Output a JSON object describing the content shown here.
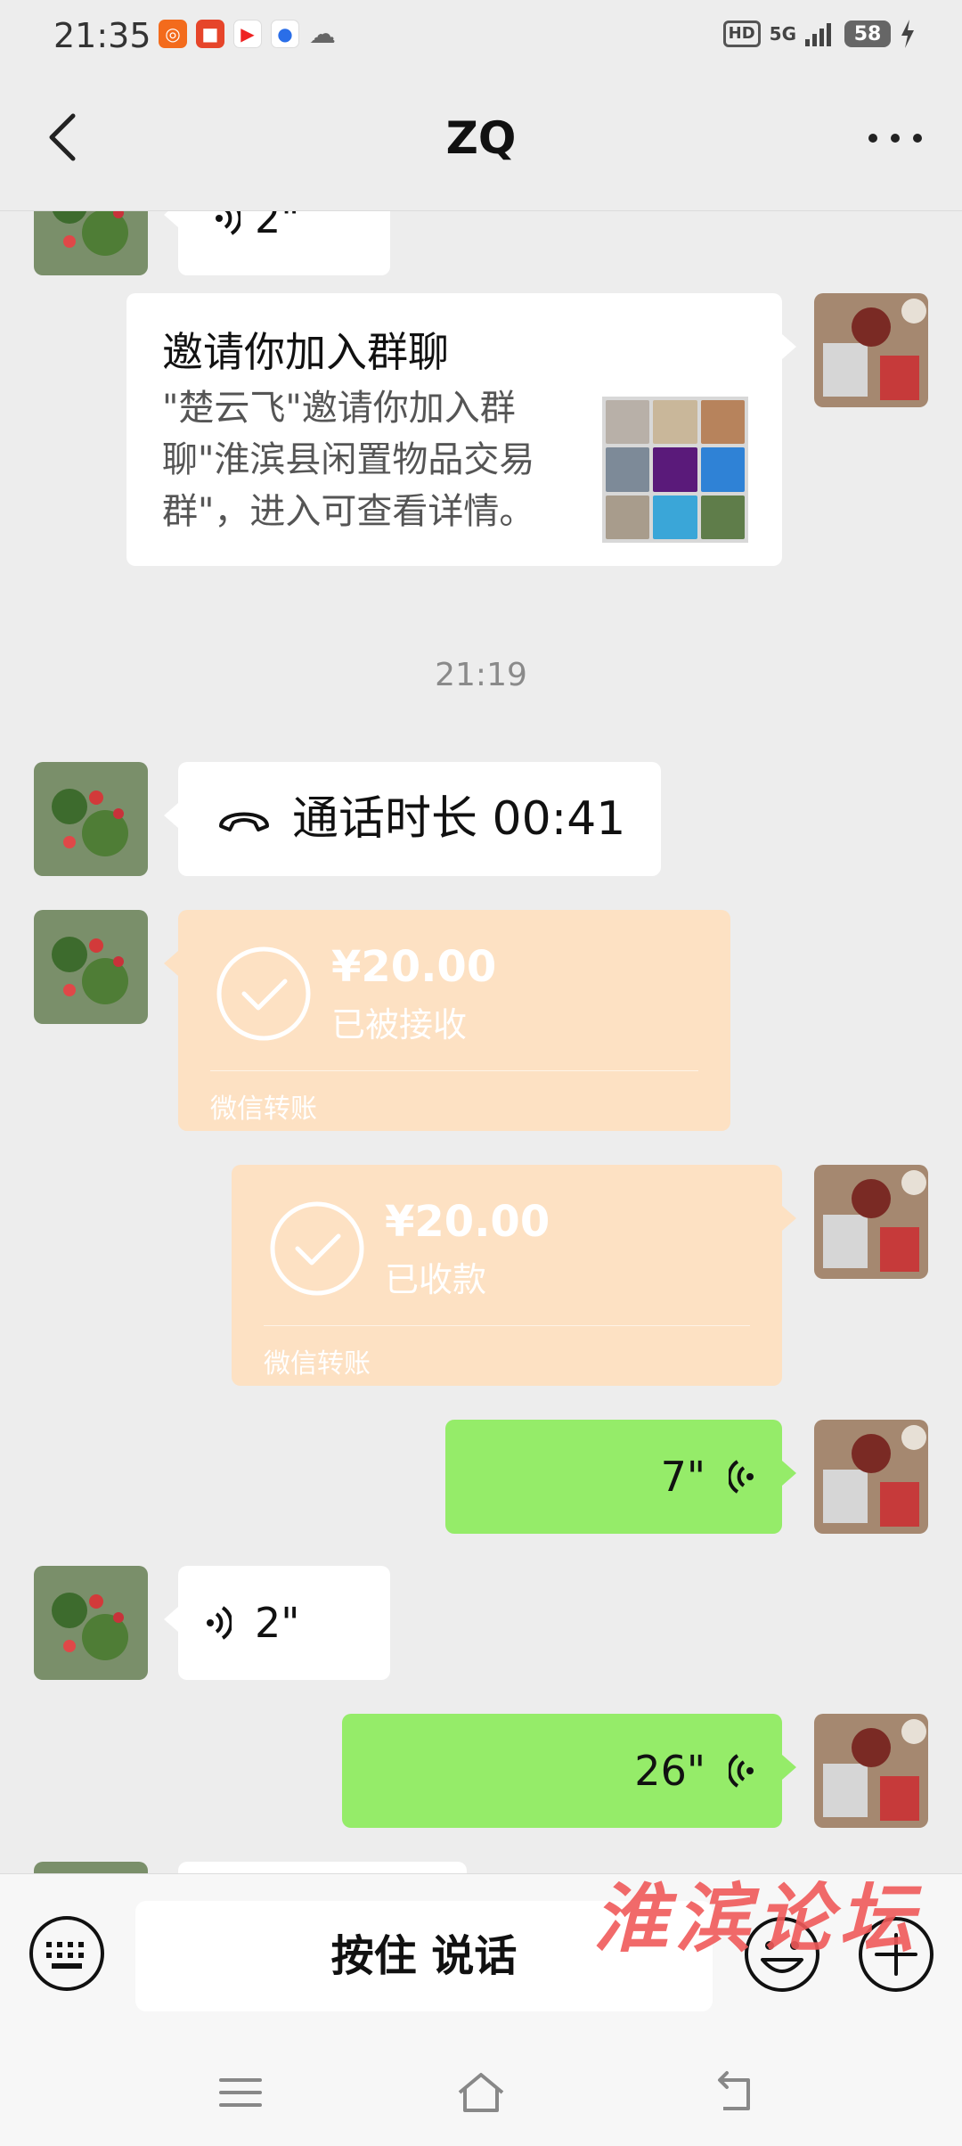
{
  "status_bar": {
    "time": "21:35",
    "hd": "HD",
    "network": "5G",
    "battery": "58"
  },
  "header": {
    "title": "ZQ"
  },
  "messages": {
    "top_partial_voice": "2\"",
    "invite": {
      "title": "邀请你加入群聊",
      "description": "\"楚云飞\"邀请你加入群聊\"淮滨县闲置物品交易群\"，进入可查看详情。"
    },
    "timestamp": "21:19",
    "call": {
      "text": "通话时长 00:41"
    },
    "transfer_received_by_them": {
      "amount": "¥20.00",
      "status": "已被接收",
      "label": "微信转账"
    },
    "transfer_received_by_me": {
      "amount": "¥20.00",
      "status": "已收款",
      "label": "微信转账"
    },
    "voice_sent_1": "7\"",
    "voice_received": "2\"",
    "voice_sent_2": "26\""
  },
  "input_bar": {
    "hold_to_talk": "按住 说话",
    "watermark": "淮滨论坛"
  },
  "colors": {
    "bubble_green": "#95ec69",
    "bubble_white": "#ffffff",
    "transfer_orange": "#fde1c3",
    "background": "#ededed"
  },
  "icons": [
    "back-icon",
    "more-icon",
    "voice-icon",
    "phone-icon",
    "check-icon",
    "keyboard-icon",
    "emoji-icon",
    "plus-icon",
    "menu-icon",
    "home-icon",
    "return-icon"
  ]
}
